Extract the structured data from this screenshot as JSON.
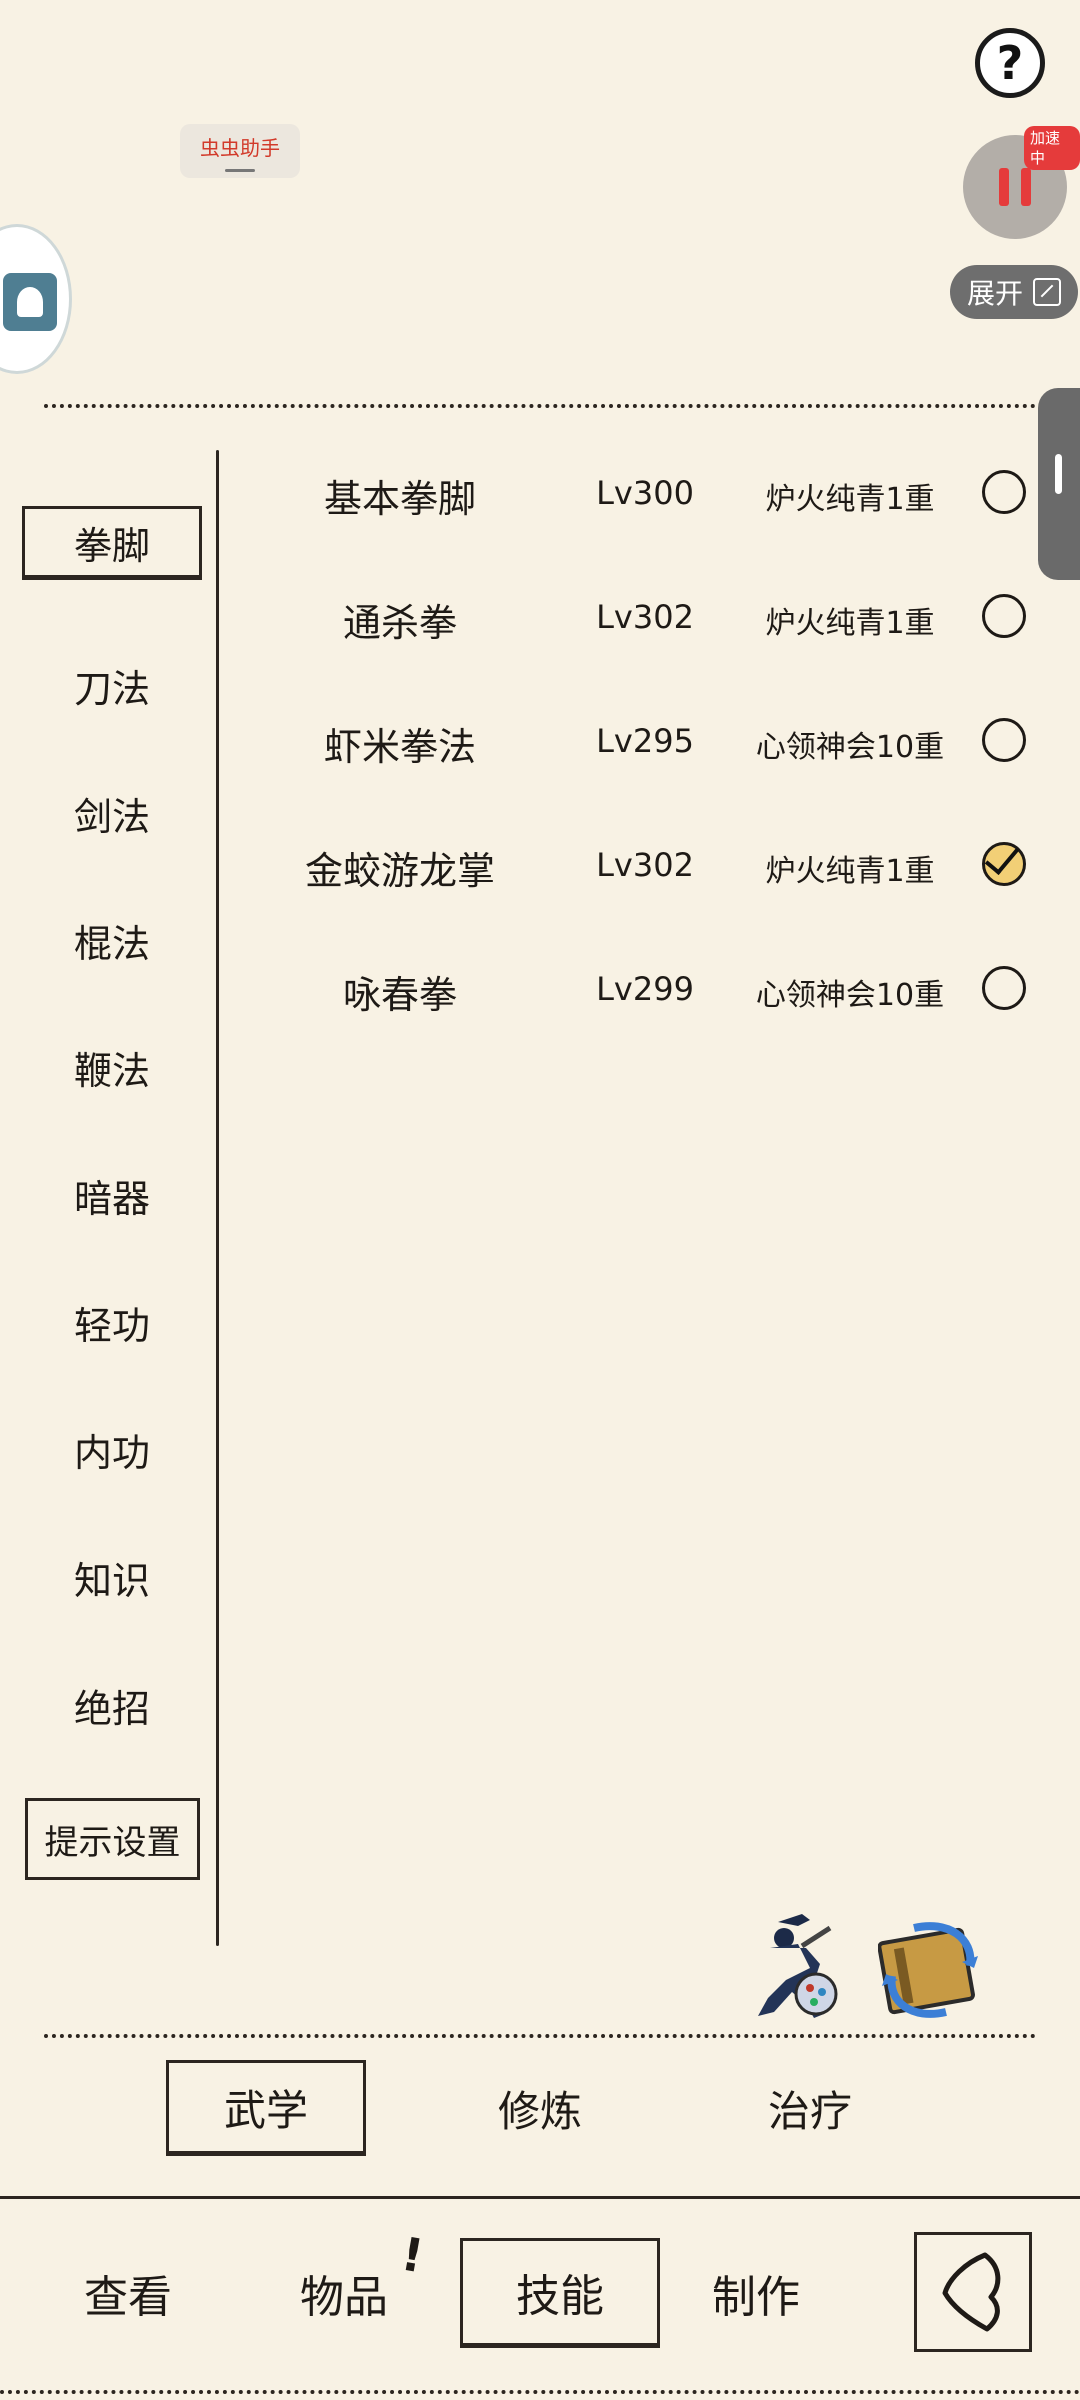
{
  "overlay": {
    "help_label": "?",
    "helper_label": "虫虫助手",
    "speed_badge": "加速中",
    "expand_label": "展开"
  },
  "sidebar": {
    "categories": [
      "拳脚",
      "刀法",
      "剑法",
      "棍法",
      "鞭法",
      "暗器",
      "轻功",
      "内功",
      "知识",
      "绝招"
    ],
    "selected_index": 0,
    "tip_settings": "提示设置"
  },
  "skills": [
    {
      "name": "基本拳脚",
      "level": "Lv300",
      "stage": "炉火纯青1重",
      "checked": false
    },
    {
      "name": "通杀拳",
      "level": "Lv302",
      "stage": "炉火纯青1重",
      "checked": false
    },
    {
      "name": "虾米拳法",
      "level": "Lv295",
      "stage": "心领神会10重",
      "checked": false
    },
    {
      "name": "金蛟游龙掌",
      "level": "Lv302",
      "stage": "炉火纯青1重",
      "checked": true
    },
    {
      "name": "咏春拳",
      "level": "Lv299",
      "stage": "心领神会10重",
      "checked": false
    }
  ],
  "sub_tabs": [
    "武学",
    "修炼",
    "治疗"
  ],
  "sub_tab_selected": "武学",
  "bottom_nav": {
    "tabs": [
      "查看",
      "物品",
      "技能",
      "制作"
    ],
    "selected": "技能",
    "item_alert": "!"
  },
  "icons": {
    "help": "question-mark-icon",
    "pause": "pause-icon",
    "expand": "expand-icon",
    "ninja": "ninja-skill-icon",
    "book": "book-exchange-icon",
    "back": "back-icon"
  },
  "colors": {
    "background": "#f8f2e4",
    "ink": "#1e1a16",
    "pause_red": "#e53b3b",
    "check_fill": "#f2cf76"
  }
}
